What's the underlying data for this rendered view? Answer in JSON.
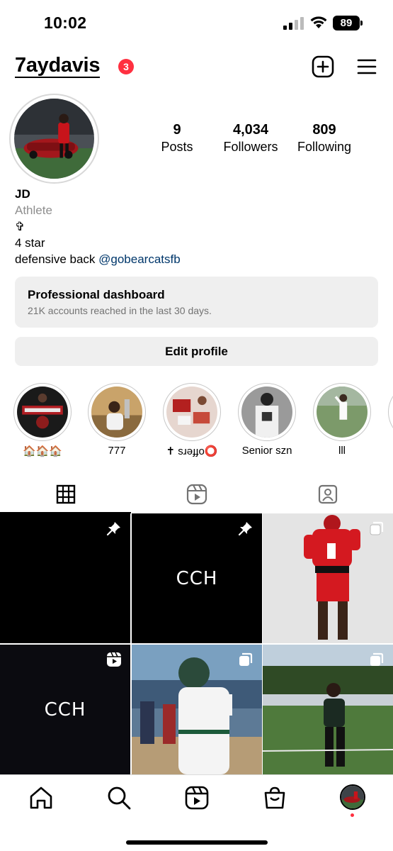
{
  "status_bar": {
    "time": "10:02",
    "battery": "89"
  },
  "header": {
    "username": "7aydavis",
    "notification_count": "3",
    "icons": [
      "plus-square-icon",
      "hamburger-menu-icon"
    ]
  },
  "stats": {
    "posts": {
      "value": "9",
      "label": "Posts"
    },
    "followers": {
      "value": "4,034",
      "label": "Followers"
    },
    "following": {
      "value": "809",
      "label": "Following"
    }
  },
  "bio": {
    "name": "JD",
    "category": "Athlete",
    "line1": "✞",
    "line2": "4 star",
    "line3_prefix": "defensive back ",
    "mention": "@gobearcatsfb"
  },
  "dashboard": {
    "title": "Professional dashboard",
    "subtitle": "21K accounts reached in the last 30 days."
  },
  "edit_profile_label": "Edit profile",
  "highlights": [
    {
      "label": "🏠🏠🏠"
    },
    {
      "label": "777"
    },
    {
      "label": "✝ sɹǝɟɟo⭕"
    },
    {
      "label": "Senior szn"
    },
    {
      "label": "lll"
    }
  ],
  "tabs": [
    {
      "icon": "grid-icon",
      "active": true
    },
    {
      "icon": "reels-icon",
      "active": false
    },
    {
      "icon": "tagged-icon",
      "active": false
    }
  ],
  "posts": [
    {
      "text": "",
      "badge": "pin-icon"
    },
    {
      "text": "CCH",
      "badge": "pin-icon"
    },
    {
      "text": "",
      "badge": "carousel-icon"
    },
    {
      "text": "CCH",
      "badge": "reels-icon"
    },
    {
      "text": "",
      "badge": "carousel-icon"
    },
    {
      "text": "",
      "badge": "carousel-icon"
    }
  ],
  "bottom_nav": [
    "home-icon",
    "search-icon",
    "reels-icon",
    "shop-icon",
    "profile-avatar"
  ],
  "colors": {
    "badge_red": "#ff3040",
    "mention_blue": "#00376b",
    "button_gray": "#efefef"
  }
}
